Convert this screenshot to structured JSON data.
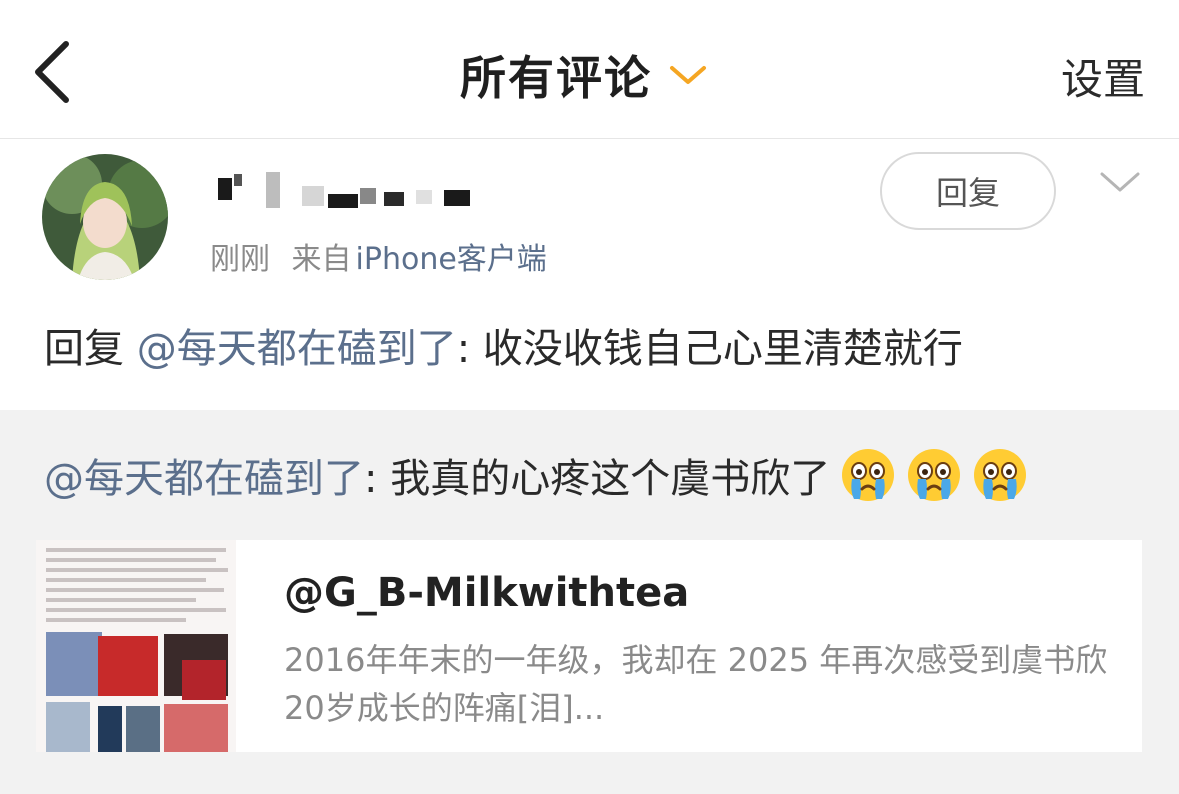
{
  "header": {
    "title": "所有评论",
    "settings_label": "设置",
    "back_icon": "chevron-left-icon",
    "title_caret_icon": "chevron-down-icon",
    "accent_color": "#F5A623"
  },
  "comment": {
    "time": "刚刚",
    "source_prefix": "来自",
    "source": "iPhone客户端",
    "reply_button_label": "回复",
    "text_prefix": "回复 ",
    "mention": "@每天都在磕到了",
    "text_body": ": 收没收钱自己心里清楚就行",
    "mention_color": "#5B6F8C"
  },
  "quote": {
    "mention": "@每天都在磕到了",
    "text_body": ": 我真的心疼这个虞书欣了",
    "emojis": [
      "crying-face-emoji",
      "crying-face-emoji",
      "crying-face-emoji"
    ]
  },
  "card": {
    "title": "@G_B-Milkwithtea",
    "description": "2016年年末的一年级，我却在 2025 年再次感受到虞书欣20岁成长的阵痛[泪]..."
  }
}
